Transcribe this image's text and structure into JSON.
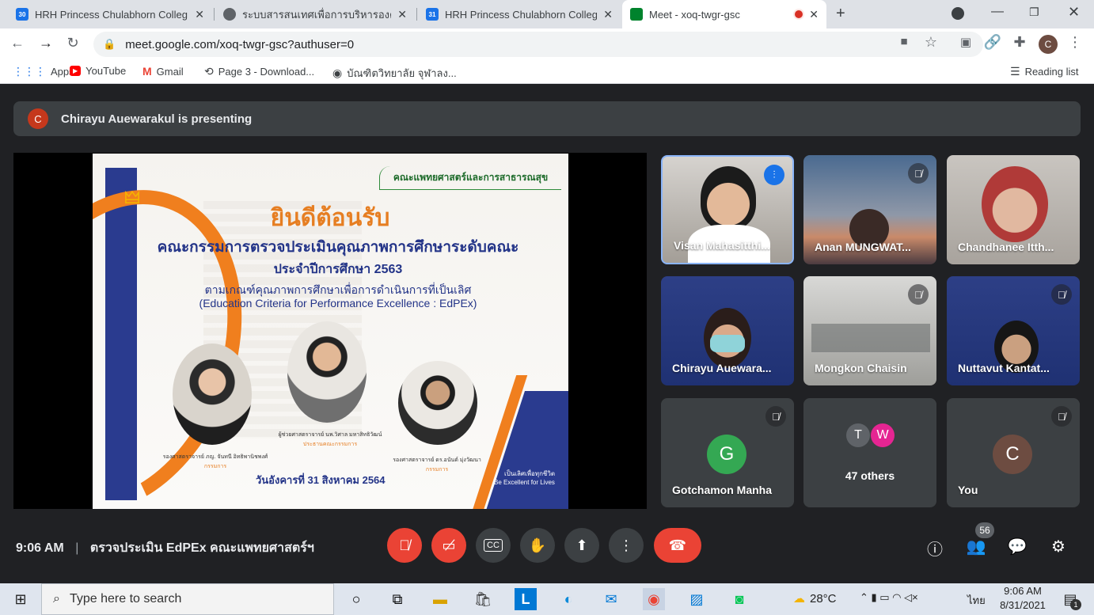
{
  "tabs": [
    {
      "label": "HRH Princess Chulabhorn Colleg",
      "icon": "calendar-icon"
    },
    {
      "label": "ระบบสารสนเทศเพื่อการบริหารองค์กร",
      "icon": "globe-icon"
    },
    {
      "label": "HRH Princess Chulabhorn Colleg",
      "icon": "calendar-icon"
    },
    {
      "label": "Meet - xoq-twgr-gsc",
      "icon": "meet-icon"
    }
  ],
  "address": {
    "url": "meet.google.com/xoq-twgr-gsc?authuser=0"
  },
  "profile_initial": "C",
  "bookmarks": [
    {
      "label": "Apps",
      "icon": "apps-grid-icon"
    },
    {
      "label": "YouTube",
      "icon": "youtube-icon"
    },
    {
      "label": "Gmail",
      "icon": "gmail-icon"
    },
    {
      "label": "Page 3 - Download...",
      "icon": "download-site-icon"
    },
    {
      "label": "บัณฑิตวิทยาลัย จุฬาลง...",
      "icon": "globe-icon"
    }
  ],
  "reading_list": "Reading list",
  "presenting": {
    "initial": "C",
    "text": "Chirayu Auewarakul is presenting"
  },
  "slide": {
    "faculty": "คณะแพทยศาสตร์และการสาธารณสุข",
    "welcome": "ยินดีต้อนรับ",
    "line1": "คณะกรรมการตรวจประเมินคุณภาพการศึกษาระดับคณะ",
    "line2": "ประจำปีการศึกษา 2563",
    "line3": "ตามเกณฑ์คุณภาพการศึกษาเพื่อการดำเนินการที่เป็นเลิศ",
    "line4": "(Education Criteria for Performance Excellence : EdPEx)",
    "person_left_name": "รองศาสตราจารย์ ภญ. จันทนี อิทธิพานิชพงศ์",
    "person_left_role": "กรรมการ",
    "person_center_name": "ผู้ช่วยศาสตราจารย์ นพ.วิศาล มหาสิทธิวัฒน์",
    "person_center_role": "ประธานคณะกรรมการ",
    "person_right_name": "รองศาสตราจารย์ ดร.อนันต์ มุ่งวัฒนา",
    "person_right_role": "กรรมการ",
    "date": "วันอังคารที่ 31 สิงหาคม 2564",
    "motto_th": "เป็นเลิศเพื่อทุกชีวิต",
    "motto_en": "Be Excellent for Lives"
  },
  "participants": [
    {
      "name": "Visan Mahasitthi...",
      "muted": false,
      "speaking": true
    },
    {
      "name": "Anan MUNGWAT...",
      "muted": true
    },
    {
      "name": "Chandhanee Itth...",
      "muted": false
    },
    {
      "name": "Chirayu Auewara...",
      "muted": false
    },
    {
      "name": "Mongkon Chaisin",
      "muted": true
    },
    {
      "name": "Nuttavut Kantat...",
      "muted": true
    },
    {
      "name": "Gotchamon Manha",
      "initial": "G",
      "muted": true,
      "color": "#34a853"
    },
    {
      "name": "47 others",
      "initials": [
        "T",
        "W"
      ]
    },
    {
      "name": "You",
      "initial": "C",
      "muted": true,
      "color": "#6d4c41"
    }
  ],
  "meeting": {
    "time": "9:06 AM",
    "separator": "|",
    "title": "ตรวจประเมิน EdPEx คณะแพทยศาสตร์ฯ",
    "people_count": "56"
  },
  "taskbar": {
    "search_placeholder": "Type here to search",
    "weather": "28°C",
    "lang": "ไทย",
    "time": "9:06 AM",
    "date": "8/31/2021",
    "notif_count": "1"
  }
}
